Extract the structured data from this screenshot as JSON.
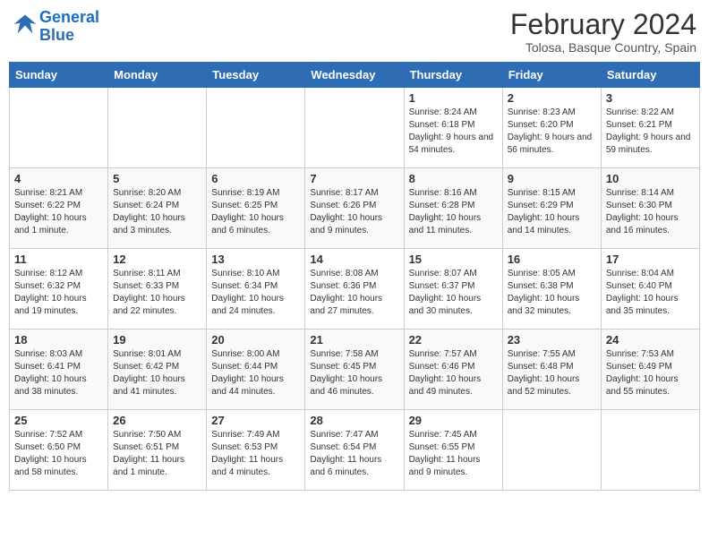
{
  "logo": {
    "line1": "General",
    "line2": "Blue"
  },
  "title": "February 2024",
  "subtitle": "Tolosa, Basque Country, Spain",
  "weekdays": [
    "Sunday",
    "Monday",
    "Tuesday",
    "Wednesday",
    "Thursday",
    "Friday",
    "Saturday"
  ],
  "weeks": [
    [
      {
        "day": "",
        "info": ""
      },
      {
        "day": "",
        "info": ""
      },
      {
        "day": "",
        "info": ""
      },
      {
        "day": "",
        "info": ""
      },
      {
        "day": "1",
        "info": "Sunrise: 8:24 AM\nSunset: 6:18 PM\nDaylight: 9 hours and 54 minutes."
      },
      {
        "day": "2",
        "info": "Sunrise: 8:23 AM\nSunset: 6:20 PM\nDaylight: 9 hours and 56 minutes."
      },
      {
        "day": "3",
        "info": "Sunrise: 8:22 AM\nSunset: 6:21 PM\nDaylight: 9 hours and 59 minutes."
      }
    ],
    [
      {
        "day": "4",
        "info": "Sunrise: 8:21 AM\nSunset: 6:22 PM\nDaylight: 10 hours and 1 minute."
      },
      {
        "day": "5",
        "info": "Sunrise: 8:20 AM\nSunset: 6:24 PM\nDaylight: 10 hours and 3 minutes."
      },
      {
        "day": "6",
        "info": "Sunrise: 8:19 AM\nSunset: 6:25 PM\nDaylight: 10 hours and 6 minutes."
      },
      {
        "day": "7",
        "info": "Sunrise: 8:17 AM\nSunset: 6:26 PM\nDaylight: 10 hours and 9 minutes."
      },
      {
        "day": "8",
        "info": "Sunrise: 8:16 AM\nSunset: 6:28 PM\nDaylight: 10 hours and 11 minutes."
      },
      {
        "day": "9",
        "info": "Sunrise: 8:15 AM\nSunset: 6:29 PM\nDaylight: 10 hours and 14 minutes."
      },
      {
        "day": "10",
        "info": "Sunrise: 8:14 AM\nSunset: 6:30 PM\nDaylight: 10 hours and 16 minutes."
      }
    ],
    [
      {
        "day": "11",
        "info": "Sunrise: 8:12 AM\nSunset: 6:32 PM\nDaylight: 10 hours and 19 minutes."
      },
      {
        "day": "12",
        "info": "Sunrise: 8:11 AM\nSunset: 6:33 PM\nDaylight: 10 hours and 22 minutes."
      },
      {
        "day": "13",
        "info": "Sunrise: 8:10 AM\nSunset: 6:34 PM\nDaylight: 10 hours and 24 minutes."
      },
      {
        "day": "14",
        "info": "Sunrise: 8:08 AM\nSunset: 6:36 PM\nDaylight: 10 hours and 27 minutes."
      },
      {
        "day": "15",
        "info": "Sunrise: 8:07 AM\nSunset: 6:37 PM\nDaylight: 10 hours and 30 minutes."
      },
      {
        "day": "16",
        "info": "Sunrise: 8:05 AM\nSunset: 6:38 PM\nDaylight: 10 hours and 32 minutes."
      },
      {
        "day": "17",
        "info": "Sunrise: 8:04 AM\nSunset: 6:40 PM\nDaylight: 10 hours and 35 minutes."
      }
    ],
    [
      {
        "day": "18",
        "info": "Sunrise: 8:03 AM\nSunset: 6:41 PM\nDaylight: 10 hours and 38 minutes."
      },
      {
        "day": "19",
        "info": "Sunrise: 8:01 AM\nSunset: 6:42 PM\nDaylight: 10 hours and 41 minutes."
      },
      {
        "day": "20",
        "info": "Sunrise: 8:00 AM\nSunset: 6:44 PM\nDaylight: 10 hours and 44 minutes."
      },
      {
        "day": "21",
        "info": "Sunrise: 7:58 AM\nSunset: 6:45 PM\nDaylight: 10 hours and 46 minutes."
      },
      {
        "day": "22",
        "info": "Sunrise: 7:57 AM\nSunset: 6:46 PM\nDaylight: 10 hours and 49 minutes."
      },
      {
        "day": "23",
        "info": "Sunrise: 7:55 AM\nSunset: 6:48 PM\nDaylight: 10 hours and 52 minutes."
      },
      {
        "day": "24",
        "info": "Sunrise: 7:53 AM\nSunset: 6:49 PM\nDaylight: 10 hours and 55 minutes."
      }
    ],
    [
      {
        "day": "25",
        "info": "Sunrise: 7:52 AM\nSunset: 6:50 PM\nDaylight: 10 hours and 58 minutes."
      },
      {
        "day": "26",
        "info": "Sunrise: 7:50 AM\nSunset: 6:51 PM\nDaylight: 11 hours and 1 minute."
      },
      {
        "day": "27",
        "info": "Sunrise: 7:49 AM\nSunset: 6:53 PM\nDaylight: 11 hours and 4 minutes."
      },
      {
        "day": "28",
        "info": "Sunrise: 7:47 AM\nSunset: 6:54 PM\nDaylight: 11 hours and 6 minutes."
      },
      {
        "day": "29",
        "info": "Sunrise: 7:45 AM\nSunset: 6:55 PM\nDaylight: 11 hours and 9 minutes."
      },
      {
        "day": "",
        "info": ""
      },
      {
        "day": "",
        "info": ""
      }
    ]
  ]
}
